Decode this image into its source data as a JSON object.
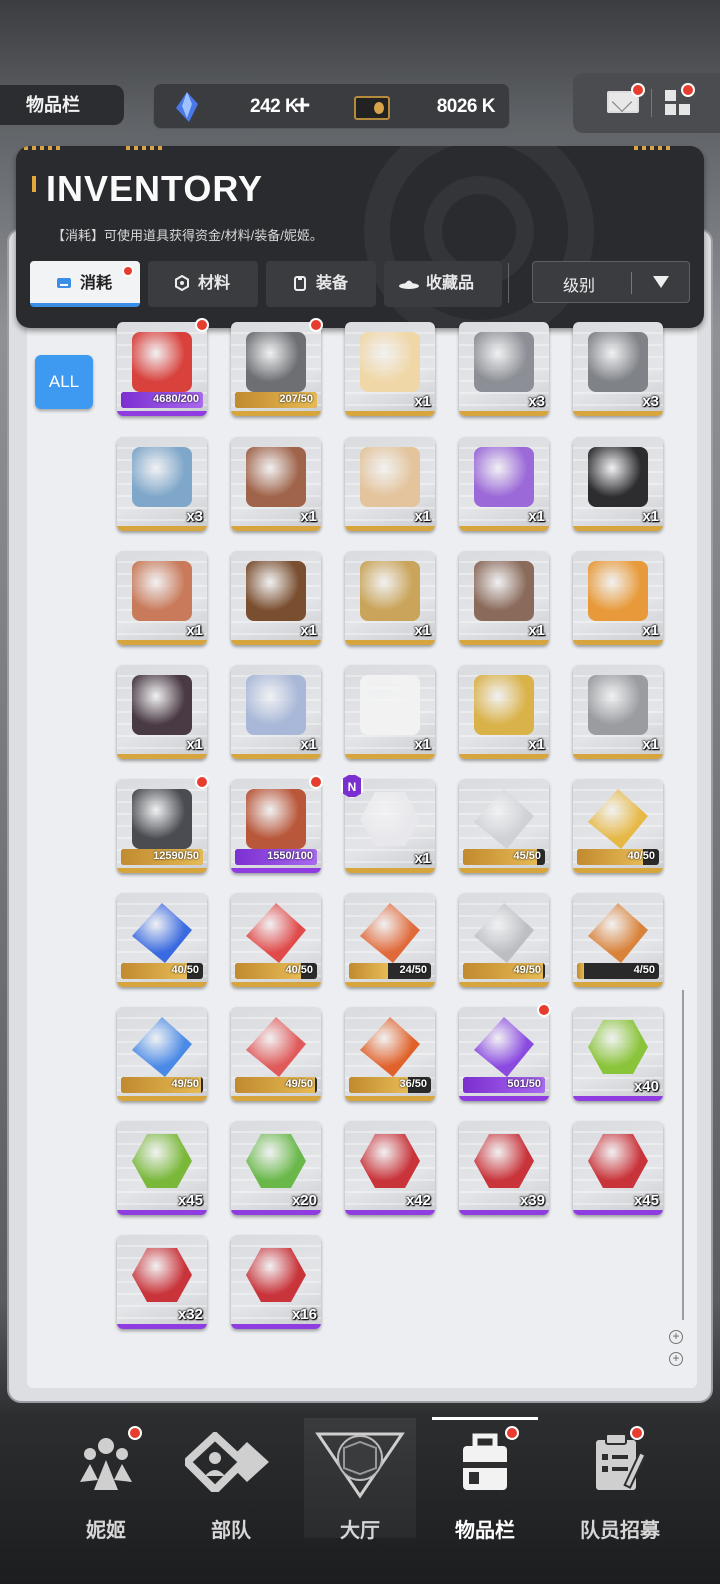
{
  "topbar": {
    "page_tag": "物品栏",
    "gems": "242 K",
    "gems_add": "+",
    "credits": "8026 K"
  },
  "header": {
    "title": "INVENTORY",
    "subtitle": "【消耗】可使用道具获得资金/材料/装备/妮姬。",
    "tabs": [
      {
        "label": "消耗",
        "active": true
      },
      {
        "label": "材料",
        "active": false
      },
      {
        "label": "装备",
        "active": false
      },
      {
        "label": "收藏品",
        "active": false
      }
    ],
    "sort_label": "级别"
  },
  "filter": {
    "all_label": "ALL"
  },
  "items": [
    {
      "id": "lucky-box",
      "count": "",
      "progress": "4680/200",
      "fill": 1.0,
      "bar": "purple",
      "dot": true,
      "color": "#d8413c"
    },
    {
      "id": "manual-box",
      "count": "",
      "progress": "207/50",
      "fill": 1.0,
      "bar": "gold",
      "dot": true,
      "color": "#6e6f73"
    },
    {
      "id": "anniversary-cake",
      "count": "x1",
      "progress": "",
      "bar": "gold",
      "color": "#f0d7a8"
    },
    {
      "id": "silver-briefs",
      "count": "x3",
      "progress": "",
      "bar": "gold",
      "color": "#8c8f95"
    },
    {
      "id": "silver-bra",
      "count": "x3",
      "progress": "",
      "bar": "gold",
      "color": "#7f8287"
    },
    {
      "id": "robot-head",
      "count": "x3",
      "progress": "",
      "bar": "gold",
      "color": "#7fa7c9"
    },
    {
      "id": "chocolate-cake",
      "count": "x1",
      "progress": "",
      "bar": "gold",
      "color": "#a0644a"
    },
    {
      "id": "1000-cake",
      "count": "x1",
      "progress": "",
      "bar": "gold",
      "color": "#e3c49c"
    },
    {
      "id": "purple-cake",
      "count": "x1",
      "progress": "",
      "bar": "gold",
      "color": "#9b6ad8"
    },
    {
      "id": "cassette-tape",
      "count": "x1",
      "progress": "",
      "bar": "gold",
      "color": "#2d2d2f"
    },
    {
      "id": "round-cake",
      "count": "x1",
      "progress": "",
      "bar": "gold",
      "color": "#c87a5a"
    },
    {
      "id": "wicker-basket",
      "count": "x1",
      "progress": "",
      "bar": "gold",
      "color": "#7a4f30"
    },
    {
      "id": "gold-badge",
      "count": "x1",
      "progress": "",
      "bar": "gold",
      "color": "#c9a45a"
    },
    {
      "id": "15-cake",
      "count": "x1",
      "progress": "",
      "bar": "gold",
      "color": "#8a6a5a"
    },
    {
      "id": "pizza",
      "count": "x1",
      "progress": "",
      "bar": "gold",
      "color": "#e89a3a"
    },
    {
      "id": "cooking-pot",
      "count": "x1",
      "progress": "",
      "bar": "gold",
      "color": "#4a3a44"
    },
    {
      "id": "acrylic-keychain",
      "count": "x1",
      "progress": "",
      "bar": "gold",
      "color": "#a9b8d8"
    },
    {
      "id": "bunny-letter",
      "count": "x1",
      "progress": "",
      "bar": "gold",
      "color": "#f2f2f2"
    },
    {
      "id": "gold-canister",
      "count": "x1",
      "progress": "",
      "bar": "gold",
      "color": "#d9b24a"
    },
    {
      "id": "silver-figure",
      "count": "x1",
      "progress": "",
      "bar": "gold",
      "color": "#9a9ca0"
    },
    {
      "id": "dark-box",
      "count": "",
      "progress": "12590/50",
      "fill": 1.0,
      "bar": "gold",
      "dot": true,
      "color": "#4a4c52"
    },
    {
      "id": "orange-container",
      "count": "",
      "progress": "1550/100",
      "fill": 1.0,
      "bar": "purple",
      "dot": true,
      "color": "#b8573a"
    },
    {
      "id": "character-chip",
      "count": "x1",
      "progress": "",
      "bar": "gold",
      "badge": "N",
      "color": "#e8e8ec"
    },
    {
      "id": "ssr-a-core",
      "count": "",
      "progress": "45/50",
      "fill": 0.9,
      "bar": "gold",
      "color": "#cfd1d5"
    },
    {
      "id": "ssr-t-core",
      "count": "",
      "progress": "40/50",
      "fill": 0.8,
      "bar": "gold",
      "color": "#e6b845"
    },
    {
      "id": "ssr-n-core-blue",
      "count": "",
      "progress": "40/50",
      "fill": 0.8,
      "bar": "gold",
      "color": "#3a6ae0"
    },
    {
      "id": "ssr-grid-core-red",
      "count": "",
      "progress": "40/50",
      "fill": 0.8,
      "bar": "gold",
      "color": "#e04a4a"
    },
    {
      "id": "ssr-core-orange",
      "count": "",
      "progress": "24/50",
      "fill": 0.48,
      "bar": "gold",
      "color": "#e06a3a"
    },
    {
      "id": "a-core-silver",
      "count": "",
      "progress": "49/50",
      "fill": 0.98,
      "bar": "gold",
      "color": "#bcbec3"
    },
    {
      "id": "t-core-orange",
      "count": "",
      "progress": "4/50",
      "fill": 0.08,
      "bar": "gold",
      "color": "#d9823a"
    },
    {
      "id": "n-core-blue",
      "count": "",
      "progress": "49/50",
      "fill": 0.98,
      "bar": "gold",
      "color": "#4a8ae6"
    },
    {
      "id": "grid-core-red",
      "count": "",
      "progress": "49/50",
      "fill": 0.98,
      "bar": "gold",
      "color": "#e05a5a"
    },
    {
      "id": "core-orange",
      "count": "",
      "progress": "36/50",
      "fill": 0.72,
      "bar": "gold",
      "color": "#e0622a"
    },
    {
      "id": "core-purple",
      "count": "",
      "progress": "501/50",
      "fill": 1.0,
      "bar": "purple",
      "dot": true,
      "color": "#8a4ae0"
    },
    {
      "id": "green-hex-chip",
      "count": "x40",
      "progress": "",
      "bar": "purple",
      "color": "#8ac43a"
    },
    {
      "id": "green-shield-chip",
      "count": "x45",
      "progress": "",
      "bar": "purple",
      "color": "#7ab83a"
    },
    {
      "id": "green-arrow-chip",
      "count": "x20",
      "progress": "",
      "bar": "purple",
      "color": "#6ab84a"
    },
    {
      "id": "red-square-chip",
      "count": "x42",
      "progress": "",
      "bar": "purple",
      "color": "#c8343a"
    },
    {
      "id": "red-a-chip",
      "count": "x39",
      "progress": "",
      "bar": "purple",
      "color": "#c8343a"
    },
    {
      "id": "red-t-chip",
      "count": "x45",
      "progress": "",
      "bar": "purple",
      "color": "#c8343a"
    },
    {
      "id": "red-n-chip",
      "count": "x32",
      "progress": "",
      "bar": "purple",
      "color": "#c8343a"
    },
    {
      "id": "red-grid-chip",
      "count": "x16",
      "progress": "",
      "bar": "purple",
      "color": "#c8343a"
    }
  ],
  "nav": [
    {
      "label": "妮姬",
      "active": false,
      "dot": true
    },
    {
      "label": "部队",
      "active": false,
      "dot": false
    },
    {
      "label": "大厅",
      "active": false,
      "dot": false
    },
    {
      "label": "物品栏",
      "active": true,
      "dot": true
    },
    {
      "label": "队员招募",
      "active": false,
      "dot": true
    }
  ]
}
